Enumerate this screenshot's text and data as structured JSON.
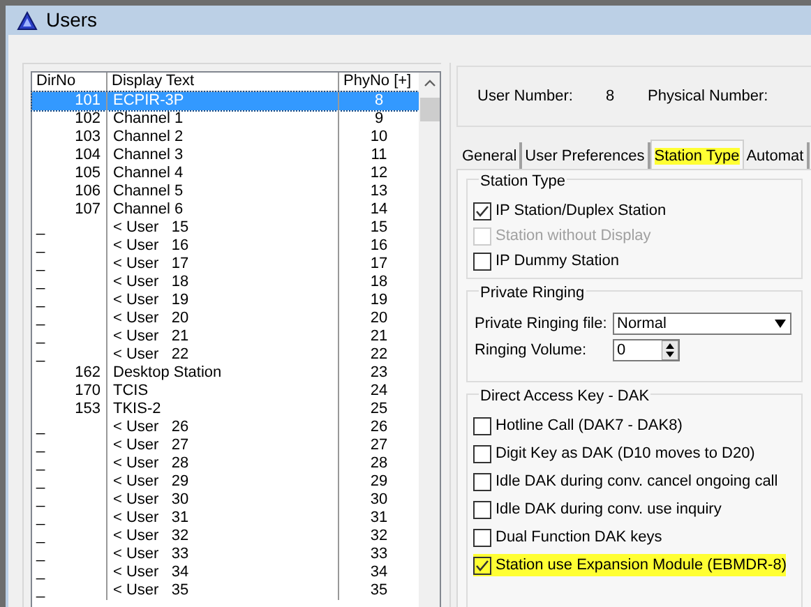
{
  "window": {
    "title": "Users"
  },
  "user_list": {
    "columns": [
      "DirNo",
      "Display Text",
      "PhyNo [+]"
    ],
    "rows": [
      {
        "dir_no": "101",
        "display_text": "ECPIR-3P",
        "phy_no": "8",
        "selected": true
      },
      {
        "dir_no": "102",
        "display_text": "Channel 1",
        "phy_no": "9",
        "selected": false
      },
      {
        "dir_no": "103",
        "display_text": "Channel 2",
        "phy_no": "10",
        "selected": false
      },
      {
        "dir_no": "104",
        "display_text": "Channel 3",
        "phy_no": "11",
        "selected": false
      },
      {
        "dir_no": "105",
        "display_text": "Channel 4",
        "phy_no": "12",
        "selected": false
      },
      {
        "dir_no": "106",
        "display_text": "Channel 5",
        "phy_no": "13",
        "selected": false
      },
      {
        "dir_no": "107",
        "display_text": "Channel 6",
        "phy_no": "14",
        "selected": false
      },
      {
        "dir_no": "_",
        "display_text": "< User   15",
        "phy_no": "15",
        "selected": false
      },
      {
        "dir_no": "_",
        "display_text": "< User   16",
        "phy_no": "16",
        "selected": false
      },
      {
        "dir_no": "_",
        "display_text": "< User   17",
        "phy_no": "17",
        "selected": false
      },
      {
        "dir_no": "_",
        "display_text": "< User   18",
        "phy_no": "18",
        "selected": false
      },
      {
        "dir_no": "_",
        "display_text": "< User   19",
        "phy_no": "19",
        "selected": false
      },
      {
        "dir_no": "_",
        "display_text": "< User   20",
        "phy_no": "20",
        "selected": false
      },
      {
        "dir_no": "_",
        "display_text": "< User   21",
        "phy_no": "21",
        "selected": false
      },
      {
        "dir_no": "_",
        "display_text": "< User   22",
        "phy_no": "22",
        "selected": false
      },
      {
        "dir_no": "162",
        "display_text": "Desktop Station",
        "phy_no": "23",
        "selected": false
      },
      {
        "dir_no": "170",
        "display_text": "TCIS",
        "phy_no": "24",
        "selected": false
      },
      {
        "dir_no": "153",
        "display_text": "TKIS-2",
        "phy_no": "25",
        "selected": false
      },
      {
        "dir_no": "_",
        "display_text": "< User   26",
        "phy_no": "26",
        "selected": false
      },
      {
        "dir_no": "_",
        "display_text": "< User   27",
        "phy_no": "27",
        "selected": false
      },
      {
        "dir_no": "_",
        "display_text": "< User   28",
        "phy_no": "28",
        "selected": false
      },
      {
        "dir_no": "_",
        "display_text": "< User   29",
        "phy_no": "29",
        "selected": false
      },
      {
        "dir_no": "_",
        "display_text": "< User   30",
        "phy_no": "30",
        "selected": false
      },
      {
        "dir_no": "_",
        "display_text": "< User   31",
        "phy_no": "31",
        "selected": false
      },
      {
        "dir_no": "_",
        "display_text": "< User   32",
        "phy_no": "32",
        "selected": false
      },
      {
        "dir_no": "_",
        "display_text": "< User   33",
        "phy_no": "33",
        "selected": false
      },
      {
        "dir_no": "_",
        "display_text": "< User   34",
        "phy_no": "34",
        "selected": false
      },
      {
        "dir_no": "_",
        "display_text": "< User   35",
        "phy_no": "35",
        "selected": false
      }
    ]
  },
  "info": {
    "user_number_label": "User Number:",
    "user_number": "8",
    "physical_number_label": "Physical Number:"
  },
  "tabs": [
    {
      "label": "General",
      "selected": false,
      "highlighted": false
    },
    {
      "label": "User Preferences",
      "selected": false,
      "highlighted": false
    },
    {
      "label": "Station Type",
      "selected": true,
      "highlighted": true
    },
    {
      "label": "Automat",
      "selected": false,
      "highlighted": false
    }
  ],
  "station_type": {
    "title": "Station Type",
    "options": [
      {
        "label": "IP Station/Duplex Station",
        "checked": true,
        "disabled": false,
        "highlighted": false
      },
      {
        "label": "Station without Display",
        "checked": false,
        "disabled": true,
        "highlighted": false
      },
      {
        "label": "IP Dummy Station",
        "checked": false,
        "disabled": false,
        "highlighted": false
      }
    ]
  },
  "private_ringing": {
    "title": "Private Ringing",
    "file_label": "Private Ringing file:",
    "file_value": "Normal",
    "volume_label": "Ringing Volume:",
    "volume_value": "0"
  },
  "dak": {
    "title": "Direct Access Key - DAK",
    "options": [
      {
        "label": "Hotline Call (DAK7 - DAK8)",
        "checked": false,
        "disabled": false,
        "highlighted": false
      },
      {
        "label": "Digit Key as DAK (D10 moves to D20)",
        "checked": false,
        "disabled": false,
        "highlighted": false
      },
      {
        "label": "Idle DAK during conv. cancel ongoing call",
        "checked": false,
        "disabled": false,
        "highlighted": false
      },
      {
        "label": "Idle DAK during conv. use inquiry",
        "checked": false,
        "disabled": false,
        "highlighted": false
      },
      {
        "label": "Dual Function DAK keys",
        "checked": false,
        "disabled": false,
        "highlighted": false
      },
      {
        "label": "Station use Expansion Module (EBMDR-8)",
        "checked": true,
        "disabled": false,
        "highlighted": true
      }
    ]
  }
}
